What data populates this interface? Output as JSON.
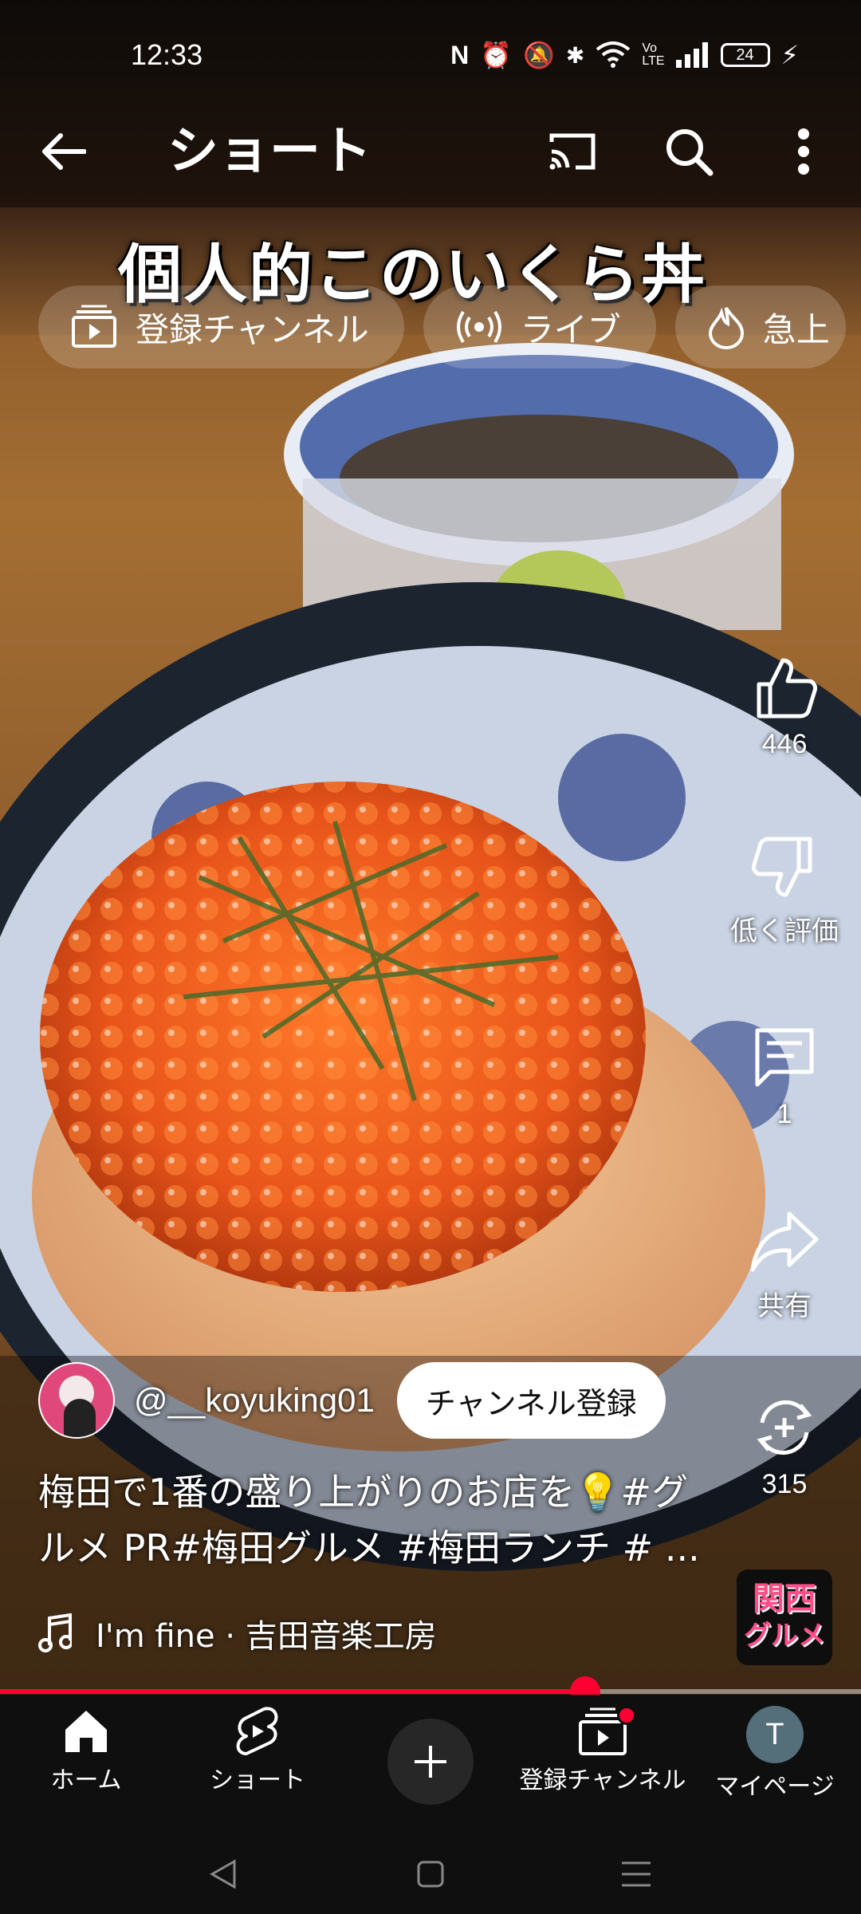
{
  "status_bar": {
    "time": "12:33",
    "battery": "24"
  },
  "top_bar": {
    "title": "ショート"
  },
  "video": {
    "caption": "個人的このいくら丼"
  },
  "chips": [
    {
      "label": "登録チャンネル",
      "icon": "subscriptions-icon"
    },
    {
      "label": "ライブ",
      "icon": "live-icon"
    },
    {
      "label": "急上",
      "icon": "trending-icon"
    }
  ],
  "actions": {
    "like_count": "446",
    "dislike_label": "低く評価",
    "comment_count": "1",
    "share_label": "共有",
    "remix_count": "315"
  },
  "channel": {
    "handle": "@__koyuking01",
    "subscribe_label": "チャンネル登録"
  },
  "description": {
    "line1": "梅田で1番の盛り上がりのお店を💡#グ",
    "line2": "ルメ PR#梅田グルメ #梅田ランチ # ..."
  },
  "music": {
    "title": "I'm fine · 吉田音楽工房",
    "thumb_line1": "関西",
    "thumb_line2": "グルメ"
  },
  "progress": {
    "fraction": 0.68
  },
  "bottom_nav": {
    "home": "ホーム",
    "shorts": "ショート",
    "subscriptions": "登録チャンネル",
    "mypage": "マイページ",
    "avatar_initial": "T"
  },
  "colors": {
    "accent": "#ff0033",
    "nav_bg": "#0f0f0f"
  }
}
